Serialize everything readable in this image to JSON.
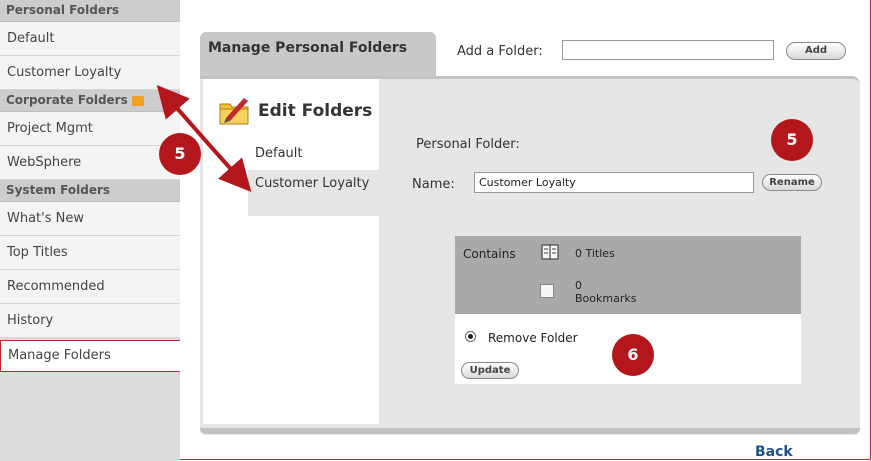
{
  "sidebar": {
    "sections": [
      {
        "header": "Personal Folders",
        "items": [
          "Default",
          "Customer Loyalty"
        ]
      },
      {
        "header": "Corporate Folders",
        "items": [
          "Project Mgmt",
          "WebSphere"
        ]
      },
      {
        "header": "System Folders",
        "items": [
          "What's New",
          "Top Titles",
          "Recommended",
          "History",
          "Manage Folders"
        ]
      }
    ],
    "active_item": "Manage Folders"
  },
  "tab": {
    "title": "Manage Personal Folders"
  },
  "add_folder": {
    "label": "Add a Folder:",
    "value": "",
    "button": "Add"
  },
  "edit_panel": {
    "title": "Edit Folders",
    "folders": [
      "Default",
      "Customer Loyalty"
    ],
    "selected_folder": "Customer Loyalty"
  },
  "details": {
    "personal_folder_label": "Personal Folder:",
    "name_label": "Name:",
    "name_value": "Customer Loyalty",
    "rename_button": "Rename",
    "contains_label": "Contains",
    "titles_count": "0 Titles",
    "bookmarks_count": "0",
    "bookmarks_label": "Bookmarks",
    "remove_option": "Remove Folder",
    "update_button": "Update"
  },
  "back_link": "Back",
  "callouts": {
    "first": "5",
    "second": "5",
    "third": "6"
  },
  "colors": {
    "accent_red": "#b3161b",
    "link_blue": "#1f4f8a",
    "panel_gray": "#e6e6e6"
  },
  "icons": [
    "folder-icon",
    "edit-folder-icon",
    "book-icon",
    "bookmark-icon",
    "radio-icon"
  ]
}
